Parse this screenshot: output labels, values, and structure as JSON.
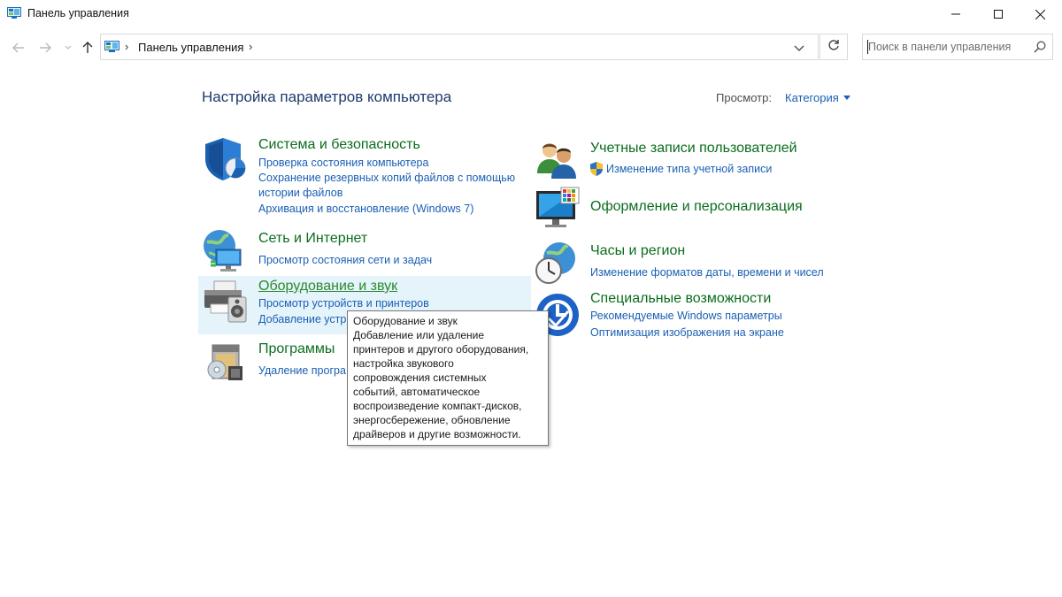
{
  "window": {
    "title": "Панель управления",
    "controls": [
      "minimize",
      "maximize",
      "close"
    ]
  },
  "nav": {
    "back_icon": "arrow-left-icon",
    "forward_icon": "arrow-right-icon",
    "recent_icon": "chevron-down-icon",
    "up_icon": "arrow-up-icon"
  },
  "address": {
    "crumb": "Панель управления",
    "separator": "›"
  },
  "search": {
    "placeholder": "Поиск в панели управления"
  },
  "header": {
    "title": "Настройка параметров компьютера",
    "view_label": "Просмотр:",
    "view_value": "Категория"
  },
  "left_categories": [
    {
      "title": "Система и безопасность",
      "icon": "shield-icon",
      "links": [
        "Проверка состояния компьютера",
        "Сохранение резервных копий файлов с помощью",
        "истории файлов",
        "Архивация и восстановление (Windows 7)"
      ]
    },
    {
      "title": "Сеть и Интернет",
      "icon": "network-globe-icon",
      "links": [
        "Просмотр состояния сети и задач"
      ]
    },
    {
      "title": "Оборудование и звук",
      "icon": "printer-speaker-icon",
      "links": [
        "Просмотр устройств и принтеров",
        "Добавление устр"
      ]
    },
    {
      "title": "Программы",
      "icon": "programs-icon",
      "links": [
        "Удаление програ"
      ]
    }
  ],
  "right_categories": [
    {
      "title": "Учетные записи пользователей",
      "icon": "users-icon",
      "links": [
        "Изменение типа учетной записи"
      ]
    },
    {
      "title": "Оформление и персонализация",
      "icon": "monitor-palette-icon",
      "links": []
    },
    {
      "title": "Часы и регион",
      "icon": "clock-globe-icon",
      "links": [
        "Изменение форматов даты, времени и чисел"
      ]
    },
    {
      "title": "Специальные возможности",
      "icon": "accessibility-icon",
      "links": [
        "Рекомендуемые Windows параметры",
        "Оптимизация изображения на экране"
      ]
    }
  ],
  "tooltip": {
    "lines": [
      "Оборудование и звук",
      "Добавление или удаление",
      "принтеров и другого оборудования,",
      "настройка звукового",
      "сопровождения системных",
      "событий, автоматическое",
      "воспроизведение компакт-дисков,",
      "энергосбережение, обновление",
      "драйверов и другие возможности."
    ]
  },
  "colors": {
    "category_title": "#0a6d1d",
    "link": "#1a5fb4",
    "page_title": "#1e3a6e",
    "hover_bg": "#e5f3fb"
  }
}
